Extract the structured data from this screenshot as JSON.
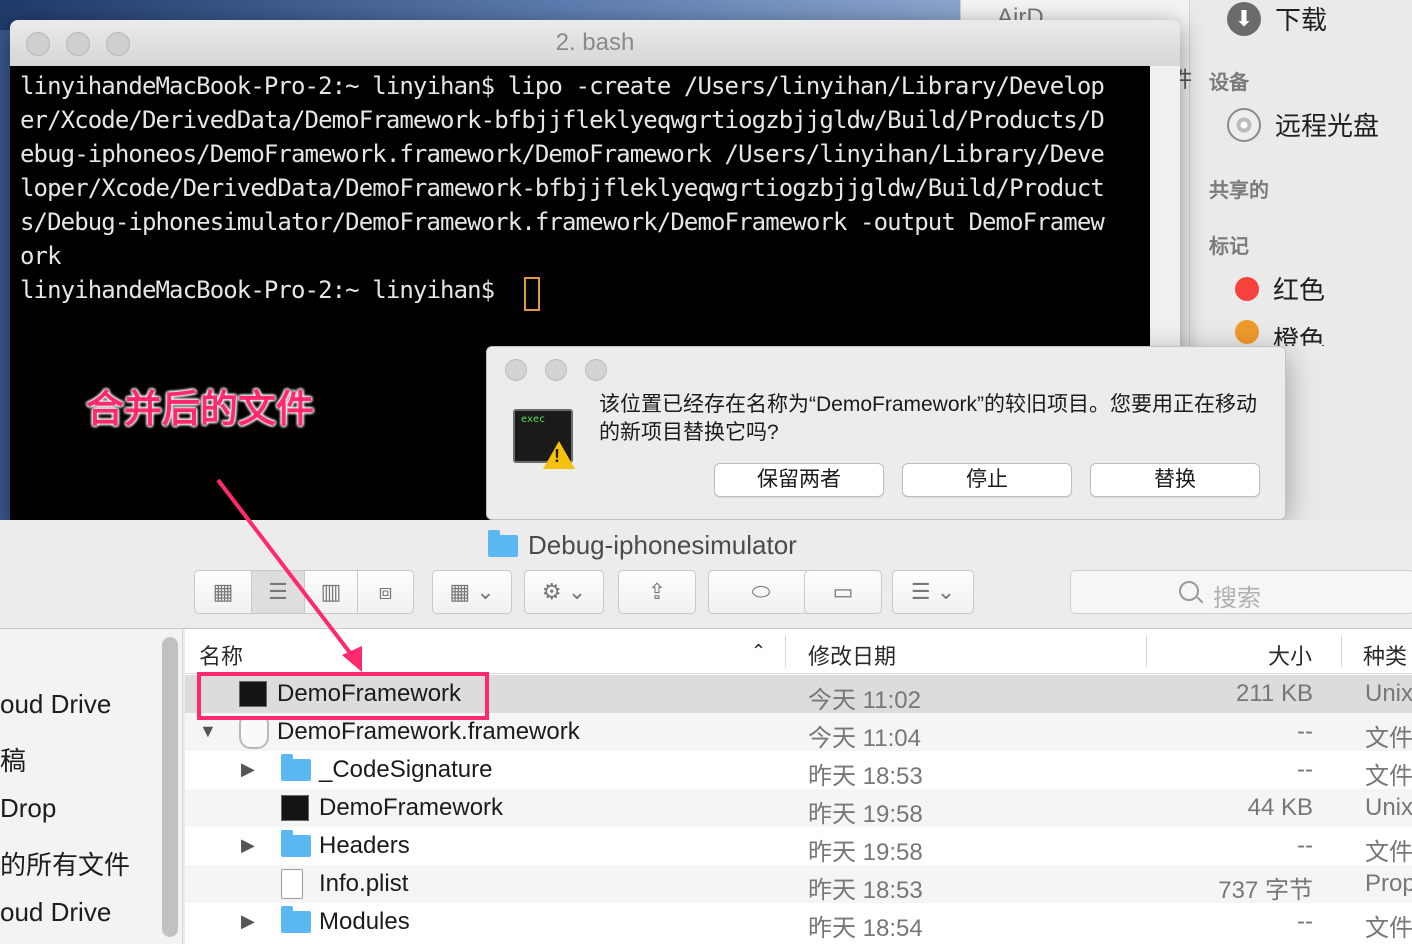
{
  "right_sidebar": {
    "top_item": "下载",
    "devices_header": "设备",
    "remote_disc": "远程光盘",
    "shared_header": "共享的",
    "tags_header": "标记",
    "tags": [
      {
        "label": "红色",
        "color": "#f5423d"
      },
      {
        "label": "橙色",
        "color": "#f09a2b"
      }
    ],
    "partial_top": "AirD",
    "partial_left": "件"
  },
  "terminal": {
    "title": "2. bash",
    "lines": [
      "linyihandeMacBook-Pro-2:~ linyihan$ lipo -create /Users/linyihan/Library/Develop",
      "er/Xcode/DerivedData/DemoFramework-bfbjjfleklyeqwgrtiogzbjjgldw/Build/Products/D",
      "ebug-iphoneos/DemoFramework.framework/DemoFramework /Users/linyihan/Library/Deve",
      "loper/Xcode/DerivedData/DemoFramework-bfbjjfleklyeqwgrtiogzbjjgldw/Build/Product",
      "s/Debug-iphonesimulator/DemoFramework.framework/DemoFramework -output DemoFramew",
      "ork",
      "linyihandeMacBook-Pro-2:~ linyihan$ "
    ]
  },
  "annotation": {
    "label": "合并后的文件",
    "color": "#ff2a6d"
  },
  "dialog": {
    "icon_text": "exec",
    "message": "该位置已经存在名称为“DemoFramework”的较旧项目。您要用正在移动的新项目替换它吗?",
    "buttons": [
      "保留两者",
      "停止",
      "替换"
    ]
  },
  "finder": {
    "title": "Debug-iphonesimulator",
    "search_placeholder": "搜索",
    "sidebar": [
      "oud Drive",
      "稿",
      "Drop",
      "的所有文件",
      "oud Drive"
    ],
    "columns": {
      "name": "名称",
      "date": "修改日期",
      "size": "大小",
      "kind": "种类"
    },
    "rows": [
      {
        "name": "DemoFramework",
        "date": "今天 11:02",
        "size": "211 KB",
        "kind": "Unix",
        "icon": "exec-icon",
        "indent": 0,
        "disclosure": "",
        "selected": true
      },
      {
        "name": "DemoFramework.framework",
        "date": "今天 11:04",
        "size": "--",
        "kind": "文件",
        "icon": "framework-icon",
        "indent": 0,
        "disclosure": "▼"
      },
      {
        "name": "_CodeSignature",
        "date": "昨天 18:53",
        "size": "--",
        "kind": "文件",
        "icon": "folder-icon",
        "indent": 1,
        "disclosure": "▶"
      },
      {
        "name": "DemoFramework",
        "date": "昨天 19:58",
        "size": "44 KB",
        "kind": "Unix",
        "icon": "exec-icon",
        "indent": 1,
        "disclosure": ""
      },
      {
        "name": "Headers",
        "date": "昨天 19:58",
        "size": "--",
        "kind": "文件",
        "icon": "folder-icon",
        "indent": 1,
        "disclosure": "▶"
      },
      {
        "name": "Info.plist",
        "date": "昨天 18:53",
        "size": "737 字节",
        "kind": "Prop",
        "icon": "plist-icon",
        "indent": 1,
        "disclosure": ""
      },
      {
        "name": "Modules",
        "date": "昨天 18:54",
        "size": "--",
        "kind": "文件",
        "icon": "folder-icon",
        "indent": 1,
        "disclosure": "▶"
      }
    ]
  }
}
